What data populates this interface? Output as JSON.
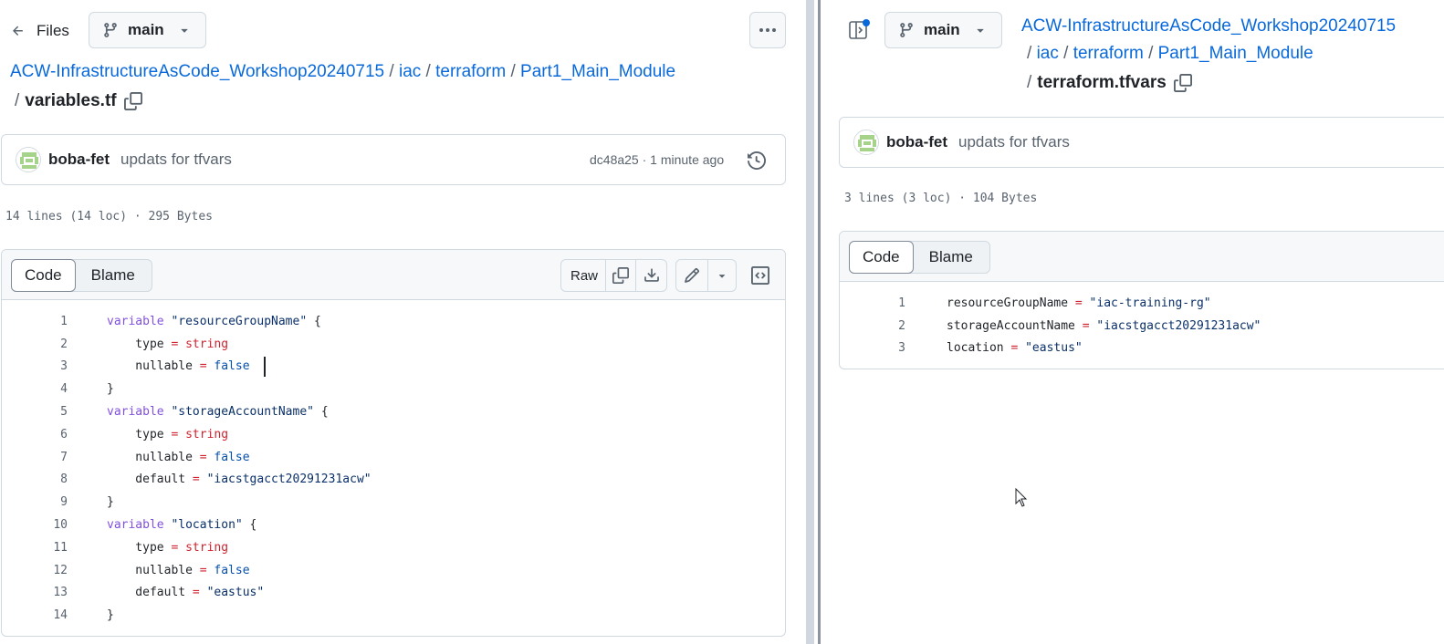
{
  "left": {
    "back_label": "Files",
    "branch": "main",
    "breadcrumb": {
      "repo": "ACW-InfrastructureAsCode_Workshop20240715",
      "parts": [
        "iac",
        "terraform",
        "Part1_Main_Module"
      ],
      "separator": "/",
      "file": "variables.tf"
    },
    "commit": {
      "author": "boba-fet",
      "message": "updats for tfvars",
      "meta": "dc48a25 · 1 minute ago"
    },
    "file_info": "14 lines (14 loc) · 295 Bytes",
    "tabs": [
      "Code",
      "Blame"
    ],
    "toolbar": {
      "raw_label": "Raw"
    },
    "code": [
      {
        "n": "1",
        "tokens": [
          {
            "t": "variable",
            "c": "kw"
          },
          {
            "t": " ",
            "c": "tok"
          },
          {
            "t": "\"resourceGroupName\"",
            "c": "str"
          },
          {
            "t": " {",
            "c": "tok"
          }
        ]
      },
      {
        "n": "2",
        "tokens": [
          {
            "t": "    type ",
            "c": "tok"
          },
          {
            "t": "=",
            "c": "op"
          },
          {
            "t": " ",
            "c": "tok"
          },
          {
            "t": "string",
            "c": "typ"
          }
        ]
      },
      {
        "n": "3",
        "tokens": [
          {
            "t": "    nullable ",
            "c": "tok"
          },
          {
            "t": "=",
            "c": "op"
          },
          {
            "t": " ",
            "c": "tok"
          },
          {
            "t": "false",
            "c": "bool"
          }
        ]
      },
      {
        "n": "4",
        "tokens": [
          {
            "t": "}",
            "c": "tok"
          }
        ]
      },
      {
        "n": "5",
        "tokens": [
          {
            "t": "variable",
            "c": "kw"
          },
          {
            "t": " ",
            "c": "tok"
          },
          {
            "t": "\"storageAccountName\"",
            "c": "str"
          },
          {
            "t": " {",
            "c": "tok"
          }
        ]
      },
      {
        "n": "6",
        "tokens": [
          {
            "t": "    type ",
            "c": "tok"
          },
          {
            "t": "=",
            "c": "op"
          },
          {
            "t": " ",
            "c": "tok"
          },
          {
            "t": "string",
            "c": "typ"
          }
        ]
      },
      {
        "n": "7",
        "tokens": [
          {
            "t": "    nullable ",
            "c": "tok"
          },
          {
            "t": "=",
            "c": "op"
          },
          {
            "t": " ",
            "c": "tok"
          },
          {
            "t": "false",
            "c": "bool"
          }
        ]
      },
      {
        "n": "8",
        "tokens": [
          {
            "t": "    default ",
            "c": "tok"
          },
          {
            "t": "=",
            "c": "op"
          },
          {
            "t": " ",
            "c": "tok"
          },
          {
            "t": "\"iacstgacct20291231acw\"",
            "c": "str"
          }
        ]
      },
      {
        "n": "9",
        "tokens": [
          {
            "t": "}",
            "c": "tok"
          }
        ]
      },
      {
        "n": "10",
        "tokens": [
          {
            "t": "variable",
            "c": "kw"
          },
          {
            "t": " ",
            "c": "tok"
          },
          {
            "t": "\"location\"",
            "c": "str"
          },
          {
            "t": " {",
            "c": "tok"
          }
        ]
      },
      {
        "n": "11",
        "tokens": [
          {
            "t": "    type ",
            "c": "tok"
          },
          {
            "t": "=",
            "c": "op"
          },
          {
            "t": " ",
            "c": "tok"
          },
          {
            "t": "string",
            "c": "typ"
          }
        ]
      },
      {
        "n": "12",
        "tokens": [
          {
            "t": "    nullable ",
            "c": "tok"
          },
          {
            "t": "=",
            "c": "op"
          },
          {
            "t": " ",
            "c": "tok"
          },
          {
            "t": "false",
            "c": "bool"
          }
        ]
      },
      {
        "n": "13",
        "tokens": [
          {
            "t": "    default ",
            "c": "tok"
          },
          {
            "t": "=",
            "c": "op"
          },
          {
            "t": " ",
            "c": "tok"
          },
          {
            "t": "\"eastus\"",
            "c": "str"
          }
        ]
      },
      {
        "n": "14",
        "tokens": [
          {
            "t": "}",
            "c": "tok"
          }
        ]
      }
    ]
  },
  "right": {
    "branch": "main",
    "breadcrumb": {
      "repo": "ACW-InfrastructureAsCode_Workshop20240715",
      "parts": [
        "iac",
        "terraform",
        "Part1_Main_Module"
      ],
      "separator": "/",
      "file": "terraform.tfvars"
    },
    "commit": {
      "author": "boba-fet",
      "message": "updats for tfvars"
    },
    "file_info": "3 lines (3 loc) · 104 Bytes",
    "tabs": [
      "Code",
      "Blame"
    ],
    "code": [
      {
        "n": "1",
        "tokens": [
          {
            "t": "resourceGroupName ",
            "c": "tok"
          },
          {
            "t": "=",
            "c": "op"
          },
          {
            "t": " ",
            "c": "tok"
          },
          {
            "t": "\"iac-training-rg\"",
            "c": "str"
          }
        ]
      },
      {
        "n": "2",
        "tokens": [
          {
            "t": "storageAccountName ",
            "c": "tok"
          },
          {
            "t": "=",
            "c": "op"
          },
          {
            "t": " ",
            "c": "tok"
          },
          {
            "t": "\"iacstgacct20291231acw\"",
            "c": "str"
          }
        ]
      },
      {
        "n": "3",
        "tokens": [
          {
            "t": "location ",
            "c": "tok"
          },
          {
            "t": "=",
            "c": "op"
          },
          {
            "t": " ",
            "c": "tok"
          },
          {
            "t": "\"eastus\"",
            "c": "str"
          }
        ]
      }
    ]
  },
  "colors": {
    "link": "#0969da",
    "keyword": "#8250df",
    "string": "#0a3069",
    "operator": "#cf222e",
    "boolean": "#0550ae",
    "divider": "#d0d7de",
    "notification_dot": "#0969da"
  },
  "icons": [
    "arrow-left-icon",
    "git-branch-icon",
    "triangle-down-icon",
    "kebab-horizontal-icon",
    "copy-icon",
    "history-icon",
    "download-icon",
    "pencil-icon",
    "code-square-icon",
    "sidebar-expand-icon",
    "mouse-cursor-icon"
  ]
}
